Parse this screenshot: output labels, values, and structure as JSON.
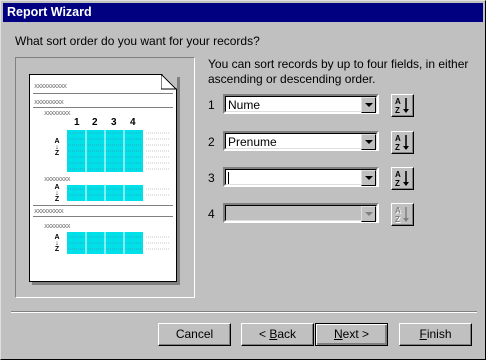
{
  "window": {
    "title": "Report Wizard"
  },
  "question": "What sort order do you want for your records?",
  "description": "You can sort records by up to four fields, in either ascending or descending order.",
  "preview": {
    "header_text": "xxxxxxxxxx",
    "group_text": "xxxxxxxxx",
    "subgroup_text": "xxxxxxxx",
    "column_numbers": [
      "1",
      "2",
      "3",
      "4"
    ],
    "cell_text": "xxxx",
    "sort_glyph_top": "A",
    "sort_glyph_bottom": "Z"
  },
  "sort_fields": [
    {
      "number": "1",
      "value": "Nume",
      "enabled": true
    },
    {
      "number": "2",
      "value": "Prenume",
      "enabled": true
    },
    {
      "number": "3",
      "value": "",
      "enabled": true
    },
    {
      "number": "4",
      "value": "",
      "enabled": false
    }
  ],
  "buttons": {
    "cancel": "Cancel",
    "back_prefix": "< ",
    "back_mnemonic": "B",
    "back_rest": "ack",
    "next_mnemonic": "N",
    "next_rest": "ext >",
    "finish_mnemonic": "F",
    "finish_rest": "inish"
  }
}
